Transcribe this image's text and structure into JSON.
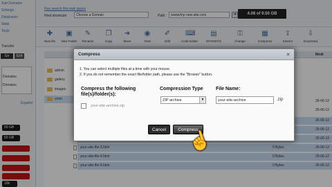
{
  "sidebar": {
    "top_link": "Sub Domains",
    "items": [
      "Settings",
      "Databases",
      "Stats",
      "Tools"
    ],
    "label_a": "Transfer",
    "btn_a": "Go",
    "btn_b": "Edit",
    "domain_rows": [
      "Domains",
      "Domains"
    ],
    "expand": "Expand",
    "pills": [
      "50 GB",
      "50 GB",
      "",
      "",
      "",
      "",
      "10k"
    ]
  },
  "topbar": {
    "search_link": "Run search this web space",
    "host_label": "Host shortcuts:",
    "host_value": "Choose a Domain",
    "path_label": "Path:",
    "path_value": "/www/my-new-site.com",
    "go_icon": "arrow-go-icon",
    "quota": "4.08 of 9.50 GB"
  },
  "toolbar": [
    {
      "icon": "new-file-icon",
      "glyph": "✚",
      "label": "New file"
    },
    {
      "icon": "new-folder-icon",
      "glyph": "▣",
      "label": "New Folder"
    },
    {
      "icon": "rename-icon",
      "glyph": "✎",
      "label": "Rename"
    },
    {
      "icon": "copy-icon",
      "glyph": "❐",
      "label": "Copy"
    },
    {
      "icon": "move-icon",
      "glyph": "➜",
      "label": "Move"
    },
    {
      "icon": "view-icon",
      "glyph": "◉",
      "label": "View"
    },
    {
      "icon": "edit-icon",
      "glyph": "✐",
      "label": "Edit"
    },
    {
      "icon": "code-editor-icon",
      "glyph": "⌨",
      "label": "Code Editor"
    },
    {
      "icon": "wysiwyg-icon",
      "glyph": "▤",
      "label": "WYSIWYG"
    },
    {
      "icon": "chmod-icon",
      "glyph": "⚿",
      "label": "Change"
    },
    {
      "icon": "compress-icon",
      "glyph": "▦",
      "label": "Compress"
    },
    {
      "icon": "extract-icon",
      "glyph": "⇪",
      "label": "Extract"
    },
    {
      "icon": "download-icon",
      "glyph": "⇩",
      "label": "Download"
    }
  ],
  "tree": [
    "admin",
    "gallery",
    "images",
    "cmm"
  ],
  "files": {
    "col_modified": "Modi",
    "rows": [
      {
        "name": "center.p",
        "size": "",
        "mod": "26-06-12"
      },
      {
        "name": "index.ht",
        "size": "",
        "mod": "26-06-12"
      },
      {
        "name": "your-site",
        "size": "",
        "mod": "26-06-12"
      },
      {
        "name": "your-site",
        "size": "",
        "mod": "26-06-12"
      },
      {
        "name": "your-site",
        "size": "",
        "mod": "26-06-12"
      },
      {
        "name": "your-site-file-3.html",
        "size": "0 Bytes",
        "mod": "26-06-12"
      },
      {
        "name": "your-site-file-4.html",
        "size": "0 Bytes",
        "mod": "26-06-12"
      },
      {
        "name": "your-site-file-5.html",
        "size": "0 Bytes",
        "mod": "26-06-12"
      }
    ]
  },
  "dialog": {
    "title": "Compress",
    "close_icon": "close-icon",
    "note1": "1. You can select multiple files at a time with your mouse.",
    "note2": "2. If you do not remember the exact file/folder path, please use the \"Browse\" button.",
    "label_files": "Compress the following file(s)/folder(s):",
    "file_value": "your-site-archive.zip",
    "label_type": "Compression Type",
    "type_value": "ZIP archive",
    "label_name": "File Name:",
    "name_value": "your-site-archive",
    "ext": ".zip",
    "cancel": "Cancel",
    "compress": "Compress"
  },
  "cursor_icon": "hand-pointer-icon"
}
